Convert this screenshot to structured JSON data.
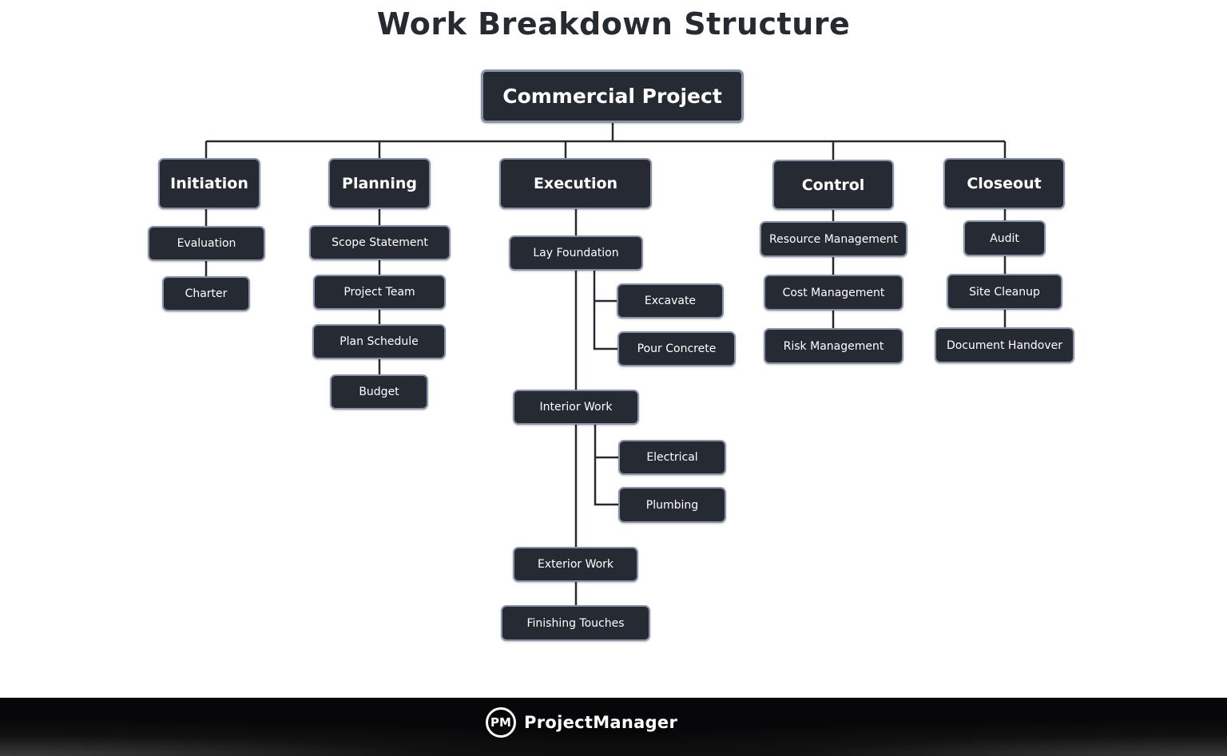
{
  "title": "Work Breakdown Structure",
  "root": {
    "label": "Commercial Project"
  },
  "phases": [
    {
      "label": "Initiation",
      "tasks": [
        "Evaluation",
        "Charter"
      ]
    },
    {
      "label": "Planning",
      "tasks": [
        "Scope Statement",
        "Project Team",
        "Plan Schedule",
        "Budget"
      ]
    },
    {
      "label": "Execution",
      "tasks": [
        {
          "label": "Lay Foundation",
          "subtasks": [
            "Excavate",
            "Pour Concrete"
          ]
        },
        {
          "label": "Interior Work",
          "subtasks": [
            "Electrical",
            "Plumbing"
          ]
        },
        {
          "label": "Exterior Work",
          "subtasks": []
        },
        {
          "label": "Finishing Touches",
          "subtasks": []
        }
      ]
    },
    {
      "label": "Control",
      "tasks": [
        "Resource Management",
        "Cost Management",
        "Risk Management"
      ]
    },
    {
      "label": "Closeout",
      "tasks": [
        "Audit",
        "Site Cleanup",
        "Document Handover"
      ]
    }
  ],
  "footer": {
    "logo_text": "PM",
    "brand": "ProjectManager"
  },
  "colors": {
    "node_fill": "#262a33",
    "node_border": "#8a93a8",
    "line": "#262a31",
    "text": "#ffffff"
  }
}
